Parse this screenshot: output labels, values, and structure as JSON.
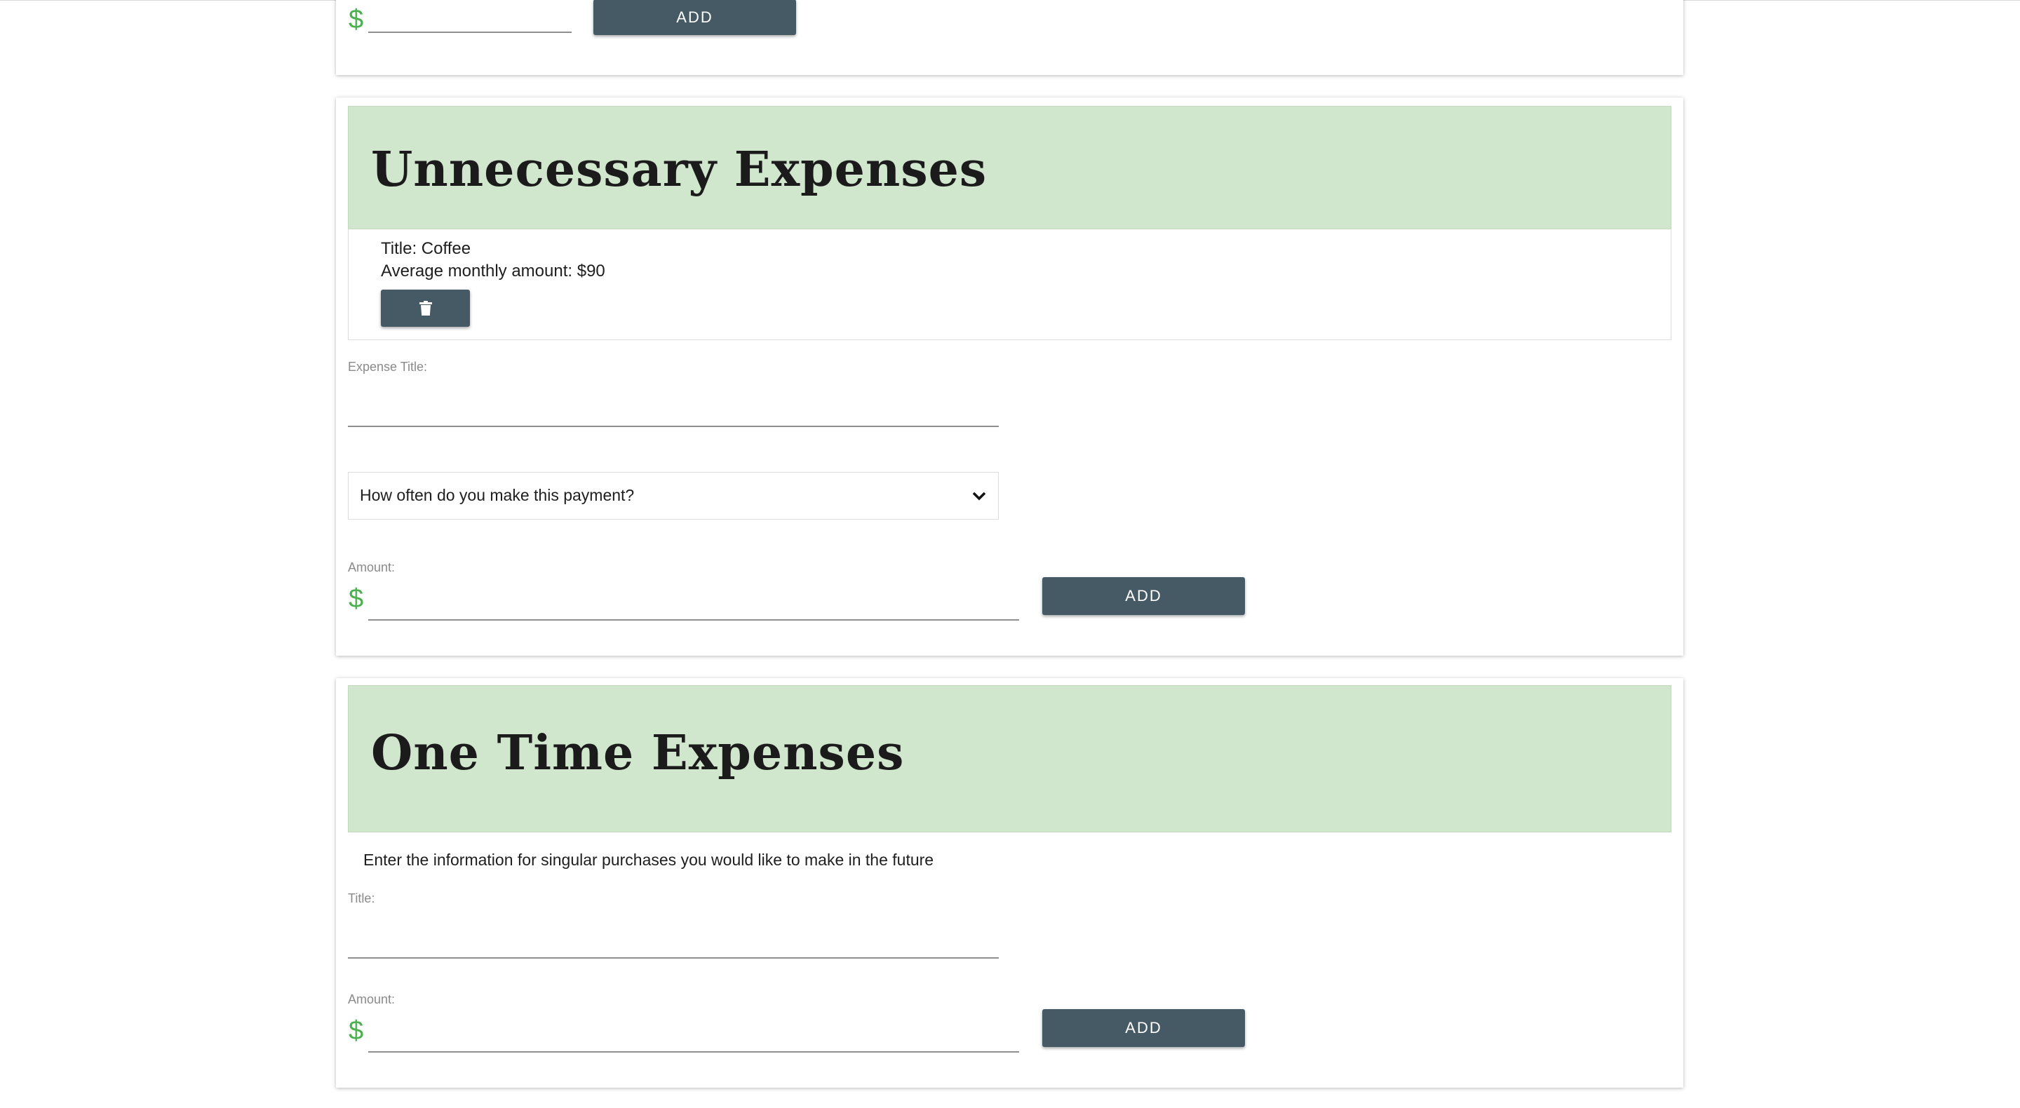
{
  "colors": {
    "banner_bg": "#d0e6cd",
    "button_bg": "#455a64",
    "dollar": "#4caf50"
  },
  "top_card": {
    "currency_symbol": "$",
    "amount_value": "",
    "add_label": "ADD"
  },
  "unnecessary": {
    "heading": "Unnecessary Expenses",
    "items": [
      {
        "title_label": "Title:",
        "title_value": "Coffee",
        "amount_label": "Average monthly amount:",
        "amount_value": "$90",
        "delete_icon": "trash-icon"
      }
    ],
    "expense_title_label": "Expense Title:",
    "expense_title_value": "",
    "frequency_select": {
      "selected": "How often do you make this payment?",
      "icon": "chevron-down-icon"
    },
    "amount_label": "Amount:",
    "currency_symbol": "$",
    "amount_value": "",
    "add_label": "ADD"
  },
  "one_time": {
    "heading": "One Time Expenses",
    "description": "Enter the information for singular purchases you would like to make in the future",
    "title_label": "Title:",
    "title_value": "",
    "amount_label": "Amount:",
    "currency_symbol": "$",
    "amount_value": "",
    "add_label": "ADD"
  }
}
